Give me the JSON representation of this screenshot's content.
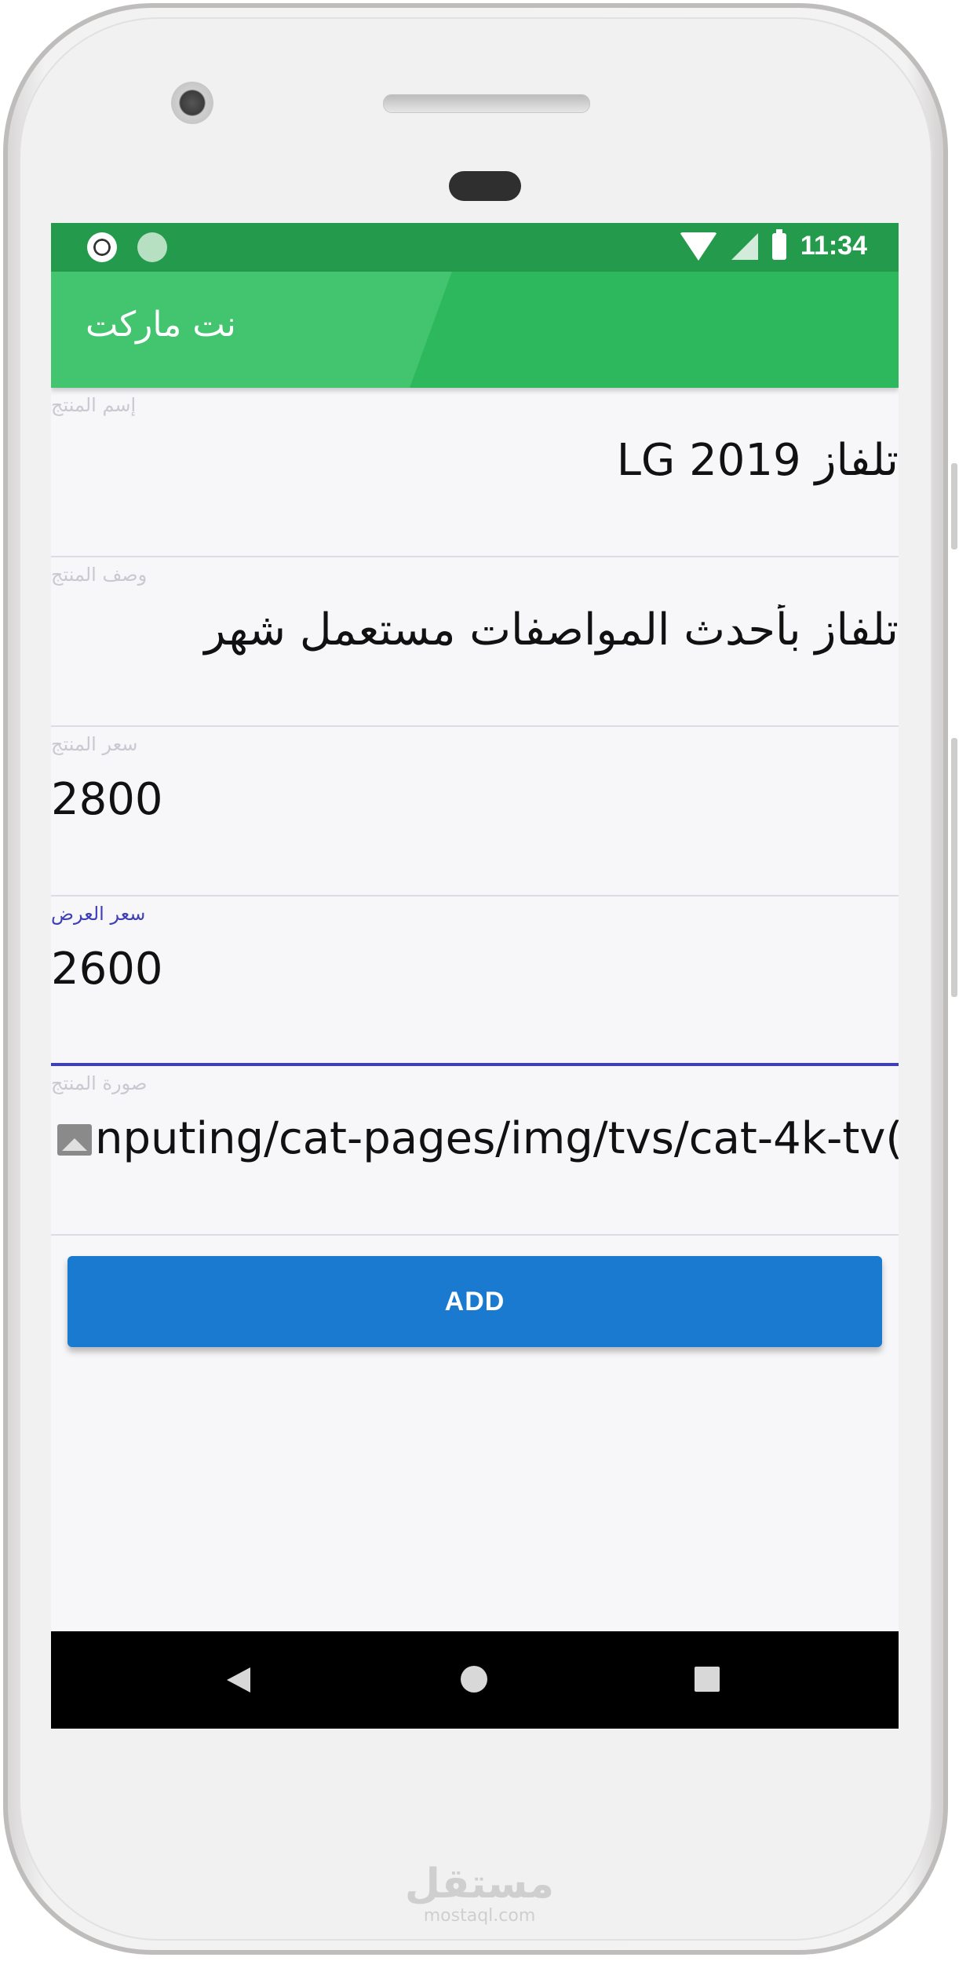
{
  "status_bar": {
    "time": "11:34"
  },
  "app_bar": {
    "title": "نت ماركت"
  },
  "form": {
    "fields": [
      {
        "label": "إسم المنتج",
        "value": "تلفاز LG 2019"
      },
      {
        "label": "وصف المنتج",
        "value": "تلفاز بأحدث المواصفات مستعمل شهر"
      },
      {
        "label": "سعر المنتج",
        "value": "2800"
      },
      {
        "label": "سعر العرض",
        "value": "2600"
      },
      {
        "label": "صورة المنتج",
        "value": "nputing/cat-pages/img/tvs/cat-4k-tv("
      }
    ],
    "add_button": "ADD"
  },
  "watermark": {
    "arabic": "مستقل",
    "latin": "mostaql.com"
  },
  "colors": {
    "status_bar": "#249a4c",
    "app_bar": "#2eb85d",
    "focus": "#3f3fb8",
    "button": "#1a7ad0"
  },
  "icons": [
    "soccer-icon",
    "circle-icon",
    "wifi-icon",
    "signal-icon",
    "battery-icon",
    "image-icon",
    "back-icon",
    "home-icon",
    "recent-apps-icon"
  ]
}
